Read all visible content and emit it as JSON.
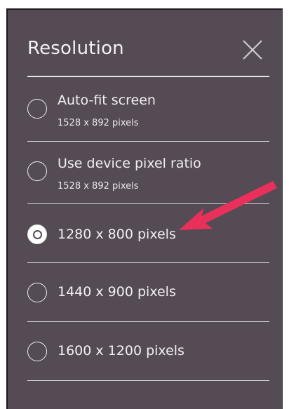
{
  "dialog": {
    "title": "Resolution",
    "close_icon": "close-icon"
  },
  "options": [
    {
      "label": "Auto-fit screen",
      "sublabel": "1528 x 892 pixels",
      "selected": false
    },
    {
      "label": "Use device pixel ratio",
      "sublabel": "1528 x 892 pixels",
      "selected": false
    },
    {
      "label": "1280 x 800 pixels",
      "selected": true
    },
    {
      "label": "1440 x 900 pixels",
      "selected": false
    },
    {
      "label": "1600 x 1200 pixels",
      "selected": false
    }
  ],
  "colors": {
    "panel_bg": "#544b54",
    "text": "#f2f0f2",
    "annotation_arrow": "#e8305a"
  },
  "annotation": {
    "icon": "arrow-annotation-icon"
  }
}
